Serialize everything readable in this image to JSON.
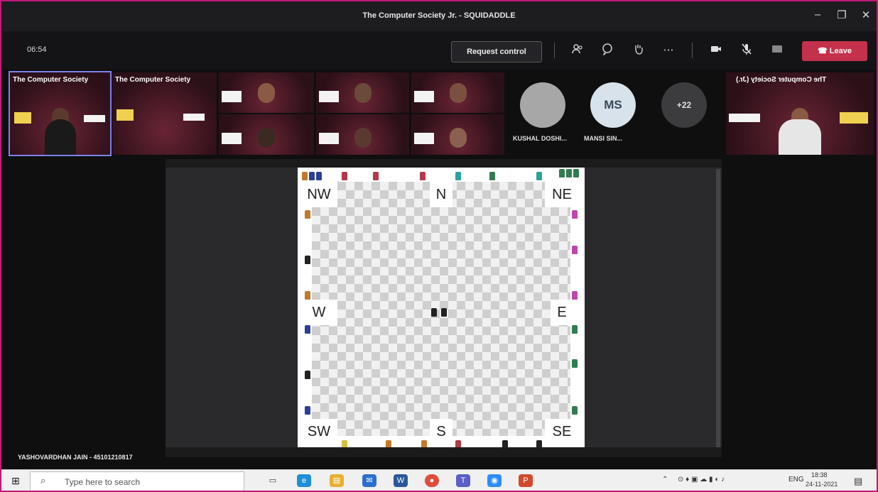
{
  "window": {
    "title": "The Computer Society Jr. - SQUIDADDLE",
    "minimize": "–",
    "maximize": "❐",
    "close": "✕"
  },
  "toolbar": {
    "timer": "06:54",
    "request_control": "Request control",
    "leave": "Leave",
    "icons": [
      "people-icon",
      "chat-icon",
      "raise-hand-icon",
      "more-icon",
      "camera-icon",
      "mic-muted-icon",
      "share-tray-icon",
      "phone-icon"
    ]
  },
  "participants": {
    "tile1_label": "The Computer Society",
    "tile2_label": "The Computer Society",
    "right_tile_label": "The Computer Society (Jr.)",
    "avatars": [
      {
        "name": "KUSHAL DOSHI...",
        "initials": ""
      },
      {
        "name": "MANSI SIN...",
        "initials": "MS"
      }
    ],
    "overflow": "+22"
  },
  "board": {
    "zones": {
      "nw": "NW",
      "n": "N",
      "ne": "NE",
      "w": "W",
      "e": "E",
      "sw": "SW",
      "s": "S",
      "se": "SE"
    },
    "colors": {
      "red": "#b23a48",
      "green": "#2f7d4f",
      "teal": "#2aa39a",
      "magenta": "#c044b0",
      "blue": "#2a3f9a",
      "orange": "#c07a2a",
      "black": "#222222",
      "yellow": "#d8c040"
    }
  },
  "presenter": "YASHOVARDHAN JAIN - 45101210817",
  "taskbar": {
    "search_placeholder": "Type here to search",
    "lang": "ENG",
    "time": "18:38",
    "date": "24-11-2021"
  },
  "colors": {
    "accent": "#7b83eb",
    "leave": "#c4314b",
    "frame": "#c2187a"
  }
}
